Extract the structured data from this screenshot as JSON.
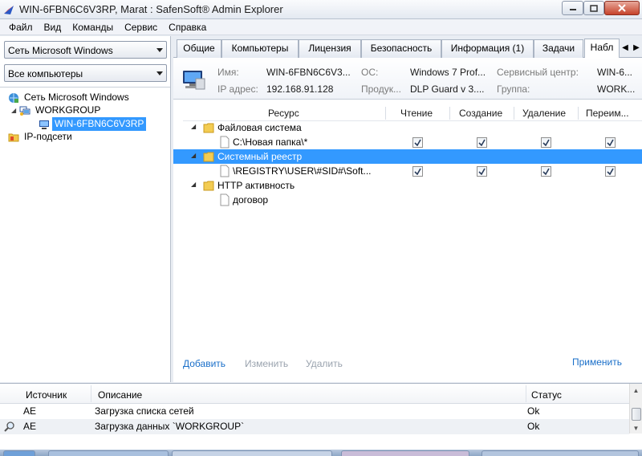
{
  "window": {
    "title": "WIN-6FBN6C6V3RP, Marat : SafenSoft® Admin Explorer"
  },
  "menu": [
    "Файл",
    "Вид",
    "Команды",
    "Сервис",
    "Справка"
  ],
  "left": {
    "network_combo": "Сеть Microsoft Windows",
    "filter_combo": "Все компьютеры",
    "tree": {
      "root": "Сеть Microsoft Windows",
      "group": "WORKGROUP",
      "computer": "WIN-6FBN6C6V3RP",
      "subnets": "IP-подсети"
    }
  },
  "tabs": [
    "Общие",
    "Компьютеры",
    "Лицензия",
    "Безопасность",
    "Информация (1)",
    "Задачи",
    "Набл"
  ],
  "info": {
    "name_label": "Имя:",
    "name_value": "WIN-6FBN6C6V3...",
    "os_label": "ОС:",
    "os_value": "Windows 7 Prof...",
    "service_center_label": "Сервисный центр:",
    "service_center_value": "WIN-6...",
    "ip_label": "IP адрес:",
    "ip_value": "192.168.91.128",
    "product_label": "Продук...",
    "product_value": "DLP Guard v 3....",
    "group_label": "Группа:",
    "group_value": "WORK..."
  },
  "grid": {
    "columns": {
      "resource": "Ресурс",
      "read": "Чтение",
      "create": "Создание",
      "delete": "Удаление",
      "rename": "Переим..."
    },
    "rows": [
      {
        "label": "Файловая система",
        "kind": "folder",
        "checked": null
      },
      {
        "label": "C:\\Новая папка\\*",
        "kind": "file",
        "checked": [
          true,
          true,
          true,
          true
        ]
      },
      {
        "label": "Системный реестр",
        "kind": "folder",
        "checked": null,
        "selected": true
      },
      {
        "label": "\\REGISTRY\\USER\\#SID#\\Soft...",
        "kind": "file",
        "checked": [
          true,
          true,
          true,
          true
        ]
      },
      {
        "label": "HTTP активность",
        "kind": "folder",
        "checked": null
      },
      {
        "label": "договор",
        "kind": "file",
        "checked": null
      }
    ],
    "actions": {
      "add": "Добавить",
      "edit": "Изменить",
      "remove": "Удалить",
      "apply": "Применить"
    }
  },
  "log": {
    "columns": {
      "source": "Источник",
      "description": "Описание",
      "status": "Статус"
    },
    "rows": [
      {
        "source": "AE",
        "description": "Загрузка списка сетей",
        "status": "Ok"
      },
      {
        "source": "AE",
        "description": "Загрузка данных `WORKGROUP`",
        "status": "Ok"
      }
    ]
  },
  "colors": {
    "selection": "#3399ff",
    "link": "#1a6fc9",
    "disabled": "#9aa3ae"
  }
}
